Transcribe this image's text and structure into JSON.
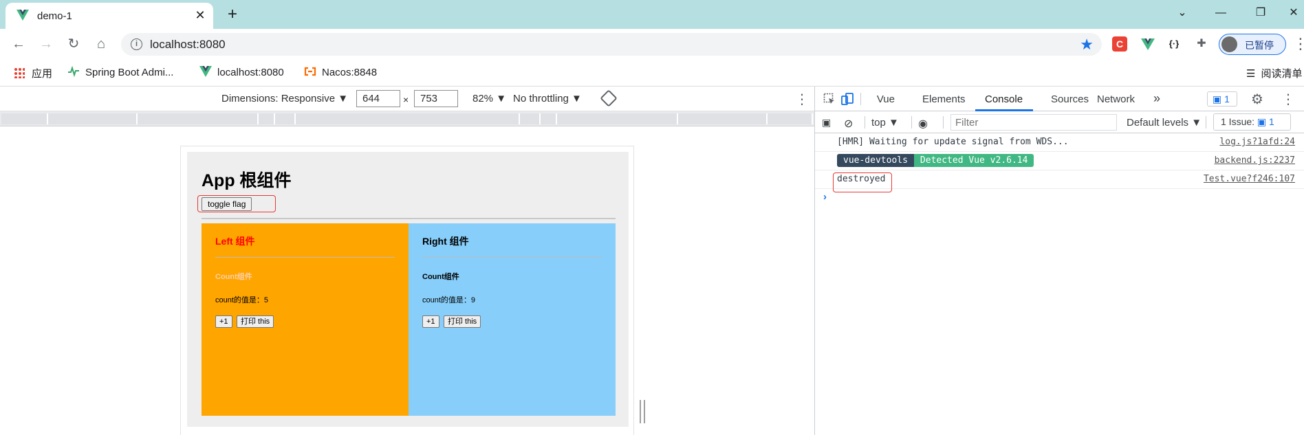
{
  "browser": {
    "tab_title": "demo-1",
    "new_tab": "+",
    "window_controls": {
      "minimize": "—",
      "restore": "❐",
      "close": "✕",
      "dropdown": "⌄"
    },
    "url": "localhost:8080",
    "profile_label": "已暂停",
    "extensions": [
      {
        "icon": "c-extension-icon",
        "text": "C",
        "color": "#ea4335"
      },
      {
        "icon": "vue-devtools-icon",
        "text": "",
        "color": "#41b883"
      },
      {
        "icon": "json-viewer-icon",
        "text": "{·}",
        "color": "#202124"
      },
      {
        "icon": "puzzle-icon",
        "text": "✚",
        "color": "#5f6368"
      }
    ]
  },
  "bookmarks": {
    "items": [
      {
        "label": "应用",
        "icon": "apps-grid-icon"
      },
      {
        "label": "Spring Boot Admi...",
        "icon": "spring-boot-admin-icon"
      },
      {
        "label": "localhost:8080",
        "icon": "vue-logo-icon"
      },
      {
        "label": "Nacos:8848",
        "icon": "nacos-icon"
      }
    ],
    "reading_list": "阅读清单"
  },
  "device_toolbar": {
    "dimensions": "Dimensions: Responsive ▼",
    "width": "644",
    "times": "×",
    "height": "753",
    "zoom": "82% ▼",
    "throttling": "No throttling ▼"
  },
  "app": {
    "title": "App 根组件",
    "toggle_button": "toggle flag",
    "left": {
      "title": "Left 组件",
      "title_color": "#ff0000",
      "count_title": "Count组件",
      "count_title_color": "#ffd0a8",
      "count_text": "count的值是：5",
      "plus_button": "+1",
      "print_button": "打印 this",
      "bg": "#ffa500"
    },
    "right": {
      "title": "Right 组件",
      "title_color": "#000000",
      "count_title": "Count组件",
      "count_title_color": "#000000",
      "count_text": "count的值是：9",
      "plus_button": "+1",
      "print_button": "打印 this",
      "bg": "#87cefa"
    }
  },
  "devtools": {
    "tabs": [
      "Vue",
      "Elements",
      "Console",
      "Sources",
      "Network"
    ],
    "active_tab": "Console",
    "more_tabs": "»",
    "issues_badge": "1",
    "console_bar": {
      "context": "top ▼",
      "filter_placeholder": "Filter",
      "levels": "Default levels ▼",
      "issue_count": "1 Issue: "
    },
    "logs": [
      {
        "message": "[HMR] Waiting for update signal from WDS...",
        "source": "log.js?1afd:24"
      },
      {
        "badge_dark": "vue-devtools",
        "badge_green": "Detected Vue v2.6.14",
        "source": "backend.js:2237"
      },
      {
        "message": "destroyed",
        "source": "Test.vue?f246:107"
      }
    ],
    "prompt": "›"
  }
}
